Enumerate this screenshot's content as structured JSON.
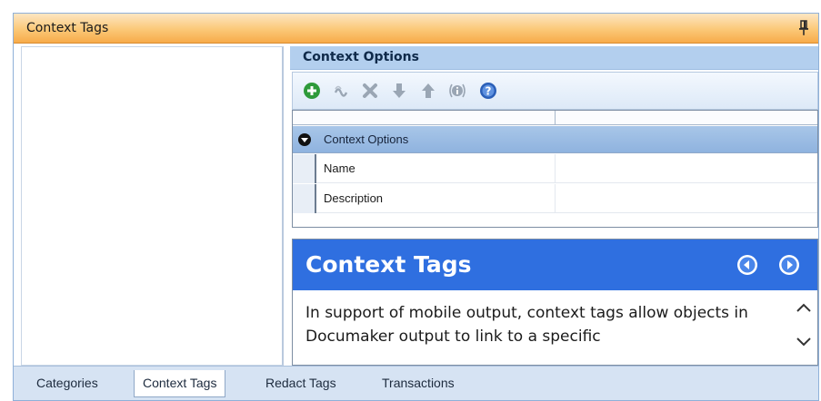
{
  "window": {
    "title": "Context Tags",
    "pin_icon": "pin-icon"
  },
  "context_options": {
    "header": "Context Options",
    "toolbar": [
      {
        "name": "add-icon",
        "color": "#2e9a3a",
        "enabled": true
      },
      {
        "name": "link-icon",
        "color": "#9aa6b4",
        "enabled": false
      },
      {
        "name": "delete-icon",
        "color": "#9aa6b4",
        "enabled": false
      },
      {
        "name": "move-down-icon",
        "color": "#9aa6b4",
        "enabled": false
      },
      {
        "name": "move-up-icon",
        "color": "#9aa6b4",
        "enabled": false
      },
      {
        "name": "info-icon",
        "color": "#9aa6b4",
        "enabled": false
      },
      {
        "name": "help-icon",
        "color": "#2a5fb8",
        "enabled": true
      }
    ],
    "grid": {
      "category_label": "Context Options",
      "properties": [
        {
          "name": "Name",
          "value": ""
        },
        {
          "name": "Description",
          "value": ""
        }
      ]
    }
  },
  "help_panel": {
    "title": "Context Tags",
    "body": "In support of mobile output, context tags allow objects in Documaker output to link to a specific",
    "nav": [
      "back-icon",
      "forward-icon"
    ]
  },
  "tabs": [
    {
      "label": "Categories",
      "active": false
    },
    {
      "label": "Context Tags",
      "active": true
    },
    {
      "label": "Redact Tags",
      "active": false
    },
    {
      "label": "Transactions",
      "active": false
    }
  ],
  "colors": {
    "title_bar": "#fbc877",
    "help_header": "#2f6fe0",
    "category_row": "#9dbde4"
  }
}
